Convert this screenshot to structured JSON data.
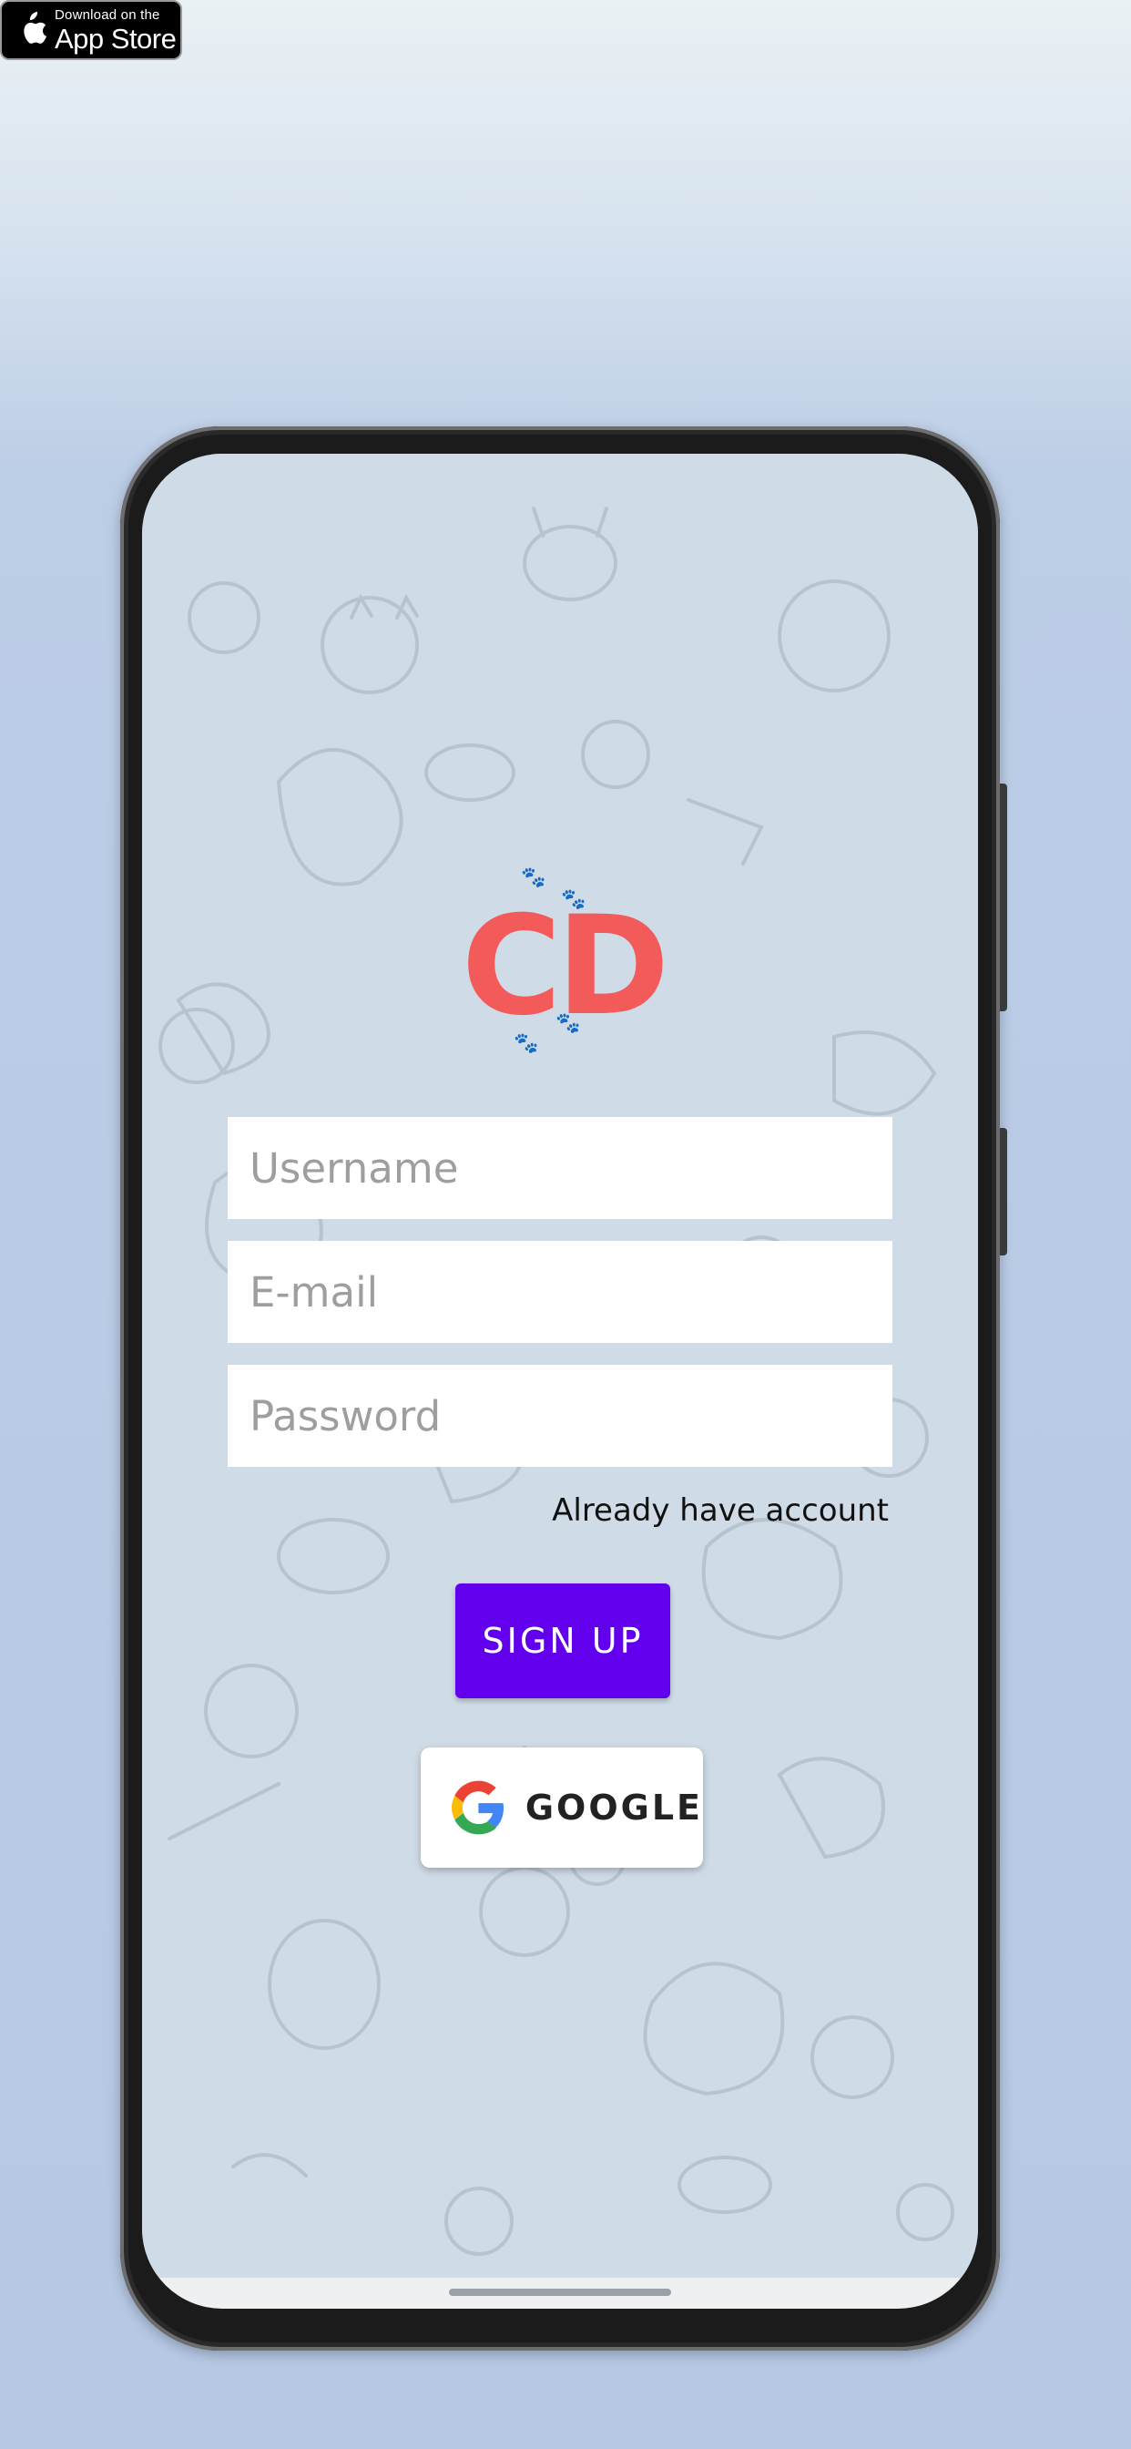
{
  "badge": {
    "line1": "Download on the",
    "line2": "App Store"
  },
  "app": {
    "logo_text": "CD",
    "fields": [
      {
        "name": "username",
        "placeholder": "Username"
      },
      {
        "name": "email",
        "placeholder": "E-mail"
      },
      {
        "name": "password",
        "placeholder": "Password"
      }
    ],
    "already_link": "Already have account",
    "signup_label": "SIGN UP",
    "google_label": "GOOGLE"
  },
  "colors": {
    "logo": "#f35b5b",
    "primary_button": "#6200ee",
    "wallpaper": "#cfdbe6"
  }
}
